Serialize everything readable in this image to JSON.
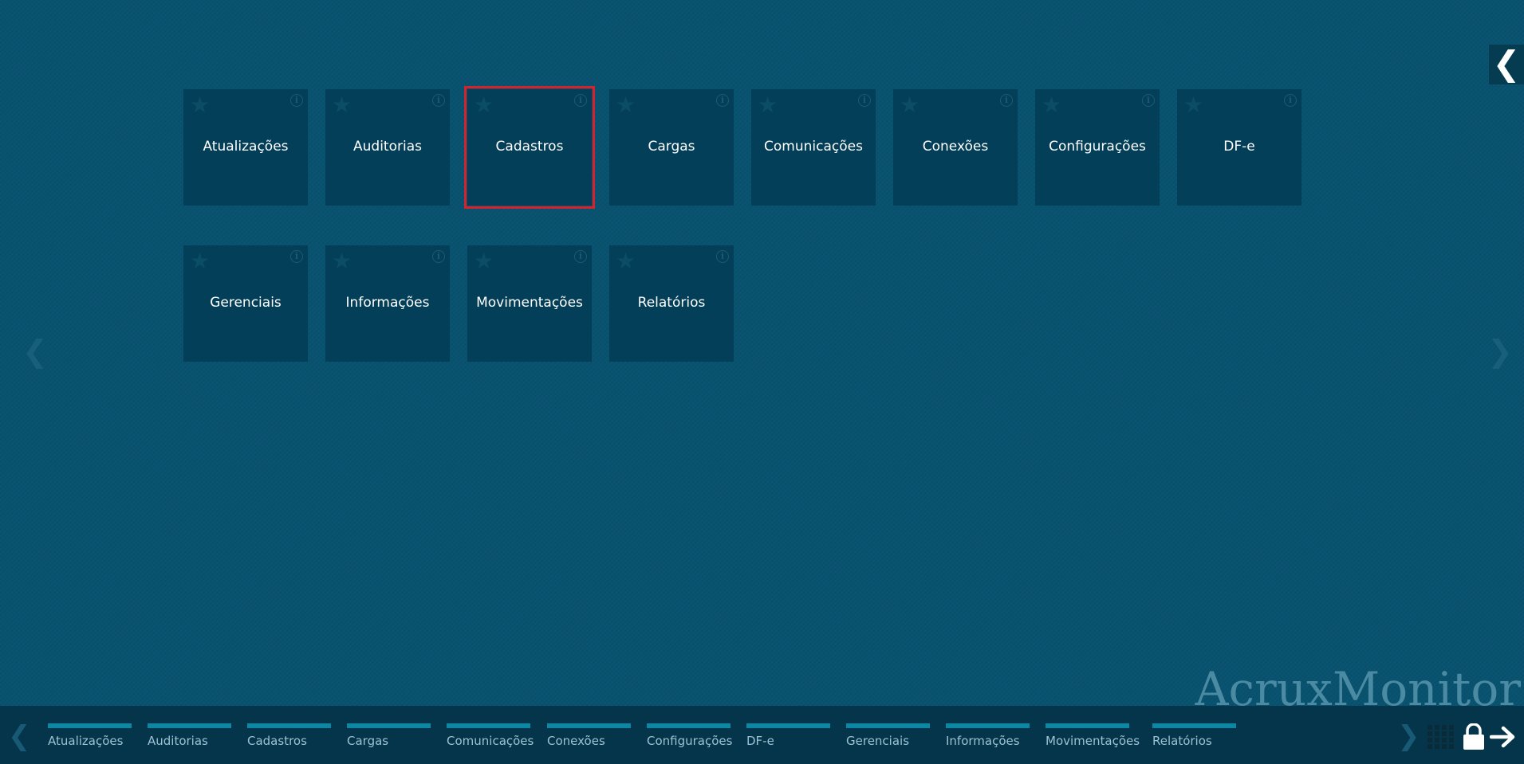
{
  "tiles": [
    {
      "label": "Atualizações"
    },
    {
      "label": "Auditorias"
    },
    {
      "label": "Cadastros"
    },
    {
      "label": "Cargas"
    },
    {
      "label": "Comunicações"
    },
    {
      "label": "Conexões"
    },
    {
      "label": "Configurações"
    },
    {
      "label": "DF-e"
    },
    {
      "label": "Gerenciais"
    },
    {
      "label": "Informações"
    },
    {
      "label": "Movimentações"
    },
    {
      "label": "Relatórios"
    }
  ],
  "selected_tile": "Cadastros",
  "tile_icons": {
    "star": "★",
    "info": "i"
  },
  "nav": {
    "left_arrow": "❮",
    "right_arrow": "❯",
    "collapse": "❮"
  },
  "watermark": "AcruxMonitor",
  "bottom_groups": [
    {
      "label": "Atualizações"
    },
    {
      "label": "Auditorias"
    },
    {
      "label": "Cadastros"
    },
    {
      "label": "Cargas"
    },
    {
      "label": "Comunicações"
    },
    {
      "label": "Conexões"
    },
    {
      "label": "Configurações"
    },
    {
      "label": "DF-e"
    },
    {
      "label": "Gerenciais"
    },
    {
      "label": "Informações"
    },
    {
      "label": "Movimentações"
    },
    {
      "label": "Relatórios"
    }
  ],
  "bottom_icons": {
    "grid": "grid-icon",
    "lock": "lock-icon",
    "logout": "arrow-right-icon"
  },
  "colors": {
    "background": "#07526f",
    "tile": "#033f58",
    "selected_border": "#d6222a",
    "bottom_bar": "#05354b",
    "group_bar": "#0e87a4"
  }
}
